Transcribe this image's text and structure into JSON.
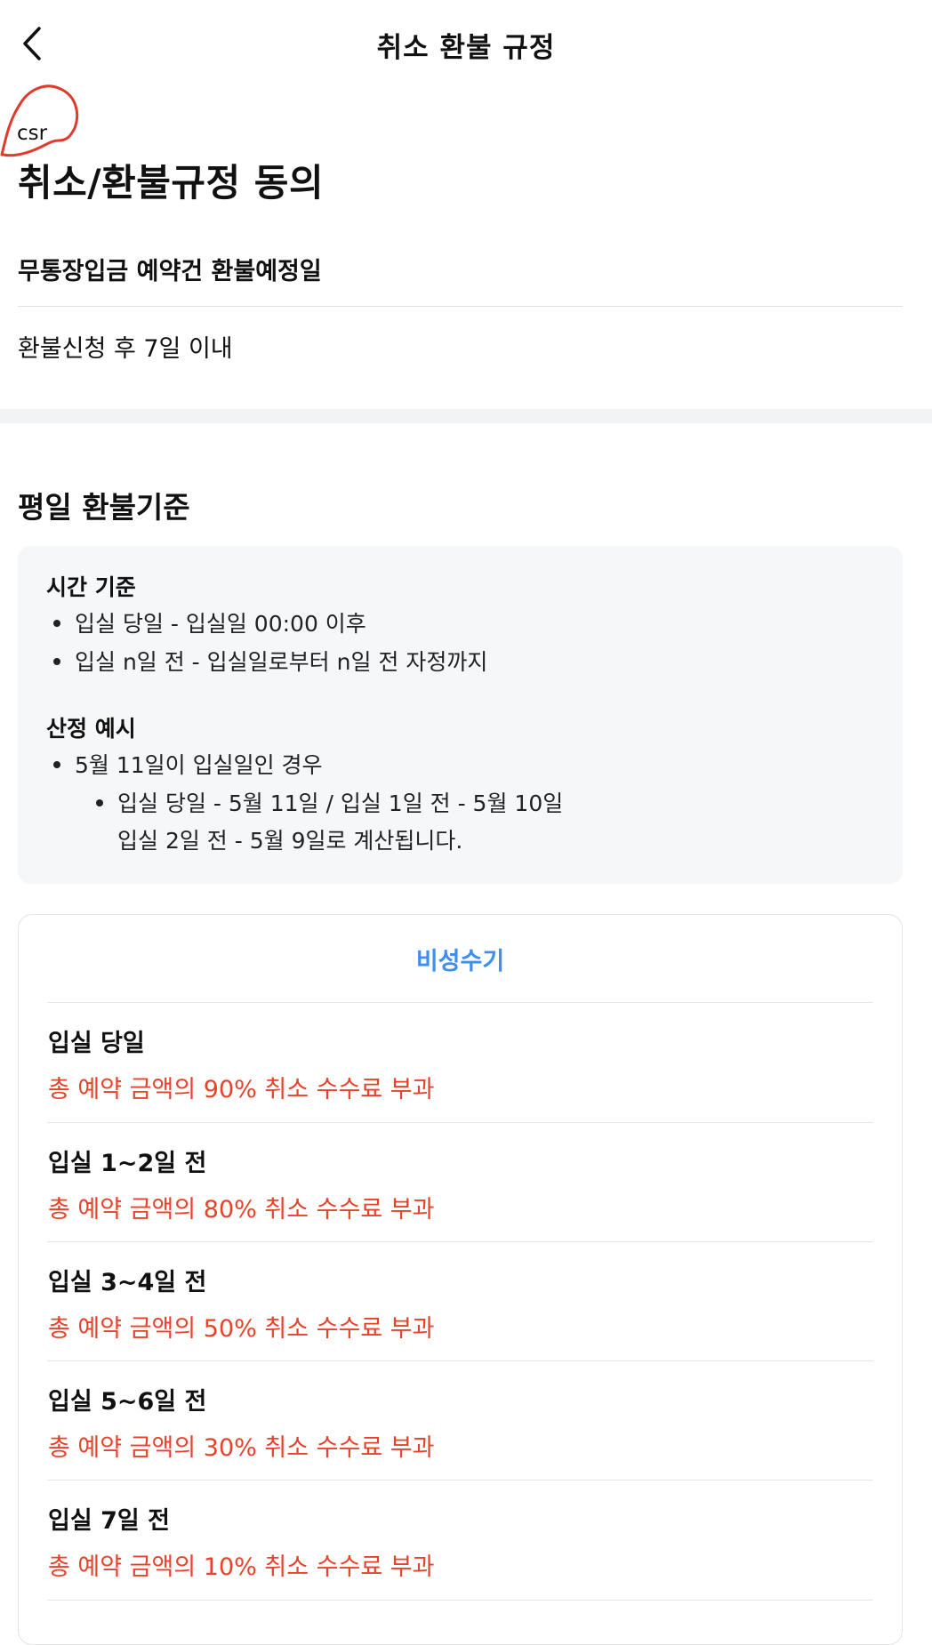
{
  "header": {
    "title": "취소 환불 규정"
  },
  "annotation": {
    "text": "csr"
  },
  "page_title": "취소/환불규정 동의",
  "deposit": {
    "heading": "무통장입금 예약건 환불예정일",
    "text": "환불신청 후 7일 이내"
  },
  "weekday": {
    "title": "평일 환불기준",
    "time_basis": {
      "label": "시간 기준",
      "items": [
        "입실 당일 - 입실일 00:00 이후",
        "입실 n일 전 - 입실일로부터 n일 전 자정까지"
      ]
    },
    "example": {
      "label": "산정 예시",
      "item": "5월 11일이 입실일인 경우",
      "sub_line1": "입실 당일 - 5월 11일 / 입실 1일 전 - 5월 10일",
      "sub_line2": "입실 2일 전 - 5월 9일로 계산됩니다."
    }
  },
  "rates": {
    "heading": "비성수기",
    "rows": [
      {
        "label": "입실 당일",
        "desc": "총 예약 금액의 90% 취소 수수료 부과"
      },
      {
        "label": "입실 1~2일 전",
        "desc": "총 예약 금액의 80% 취소 수수료 부과"
      },
      {
        "label": "입실 3~4일 전",
        "desc": "총 예약 금액의 50% 취소 수수료 부과"
      },
      {
        "label": "입실 5~6일 전",
        "desc": "총 예약 금액의 30% 취소 수수료 부과"
      },
      {
        "label": "입실 7일 전",
        "desc": "총 예약 금액의 10% 취소 수수료 부과"
      }
    ]
  },
  "colors": {
    "accent_blue": "#3d8ef0",
    "fee_red": "#e8432a",
    "annotation_red": "#e03b2a"
  }
}
